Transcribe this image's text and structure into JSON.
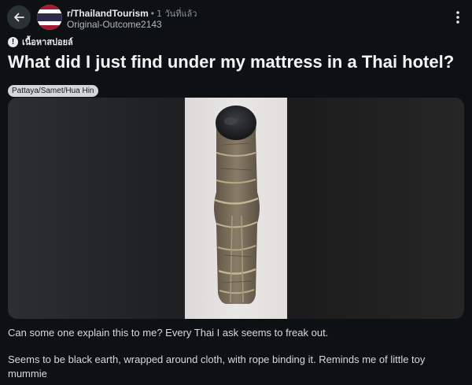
{
  "header": {
    "subreddit": "r/ThailandTourism",
    "separator": "•",
    "time_ago": "1 วันที่แล้ว",
    "author": "Original-Outcome2143"
  },
  "post": {
    "spoiler_label": "เนื้อหาสปอยล์",
    "title": "What did I just find under my mattress in a Thai hotel?",
    "flair": "Pattaya/Samet/Hua Hin",
    "body": [
      "Can some one explain this to me? Every Thai I ask seems to freak out.",
      "Seems to be black earth, wrapped around cloth, with rope binding it. Reminds me of little toy mummie"
    ]
  },
  "icons": {
    "back": "arrow-left-icon",
    "more": "more-vertical-icon",
    "spoiler": "exclamation-circle-icon",
    "avatar": "thai-flag-avatar"
  },
  "colors": {
    "background": "#0e1113",
    "flair_bg": "#d3d6da",
    "flag_red": "#a51931",
    "flag_blue": "#2d2a4a"
  }
}
